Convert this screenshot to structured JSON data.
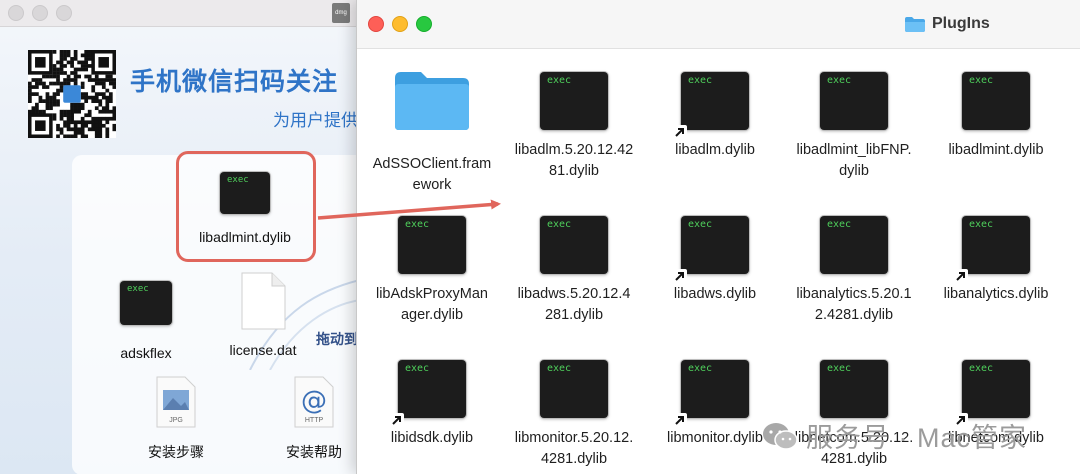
{
  "background_window": {
    "heading": "手机微信扫码关注",
    "subheading": "为用户提供",
    "drag_hint": "拖动到",
    "disk_label": "dmg",
    "highlighted_item": "libadlmint.dylib",
    "exec_badge": "exec",
    "items": [
      {
        "label": "adskflex",
        "kind": "exec"
      },
      {
        "label": "license.dat",
        "kind": "document"
      },
      {
        "label": "安装步骤",
        "kind": "jpg",
        "badge": "JPG"
      },
      {
        "label": "安装帮助",
        "kind": "http",
        "badge": "HTTP"
      }
    ]
  },
  "finder": {
    "title": "PlugIns",
    "exec_badge": "exec",
    "items": [
      {
        "name": "AdSSOClient.framework",
        "lines": [
          "AdSSOClient.fram",
          "ework"
        ],
        "kind": "folder",
        "alias": false
      },
      {
        "name": "libadlm.5.20.12.4281.dylib",
        "lines": [
          "libadlm.5.20.12.42",
          "81.dylib"
        ],
        "kind": "exec",
        "alias": false
      },
      {
        "name": "libadlm.dylib",
        "lines": [
          "libadlm.dylib"
        ],
        "kind": "exec",
        "alias": true
      },
      {
        "name": "libadlmint_libFNP.dylib",
        "lines": [
          "libadlmint_libFNP.",
          "dylib"
        ],
        "kind": "exec",
        "alias": false
      },
      {
        "name": "libadlmint.dylib",
        "lines": [
          "libadlmint.dylib"
        ],
        "kind": "exec",
        "alias": false
      },
      {
        "name": "libAdskProxyManager.dylib",
        "lines": [
          "libAdskProxyMan",
          "ager.dylib"
        ],
        "kind": "exec",
        "alias": false
      },
      {
        "name": "libadws.5.20.12.4281.dylib",
        "lines": [
          "libadws.5.20.12.4",
          "281.dylib"
        ],
        "kind": "exec",
        "alias": false
      },
      {
        "name": "libadws.dylib",
        "lines": [
          "libadws.dylib"
        ],
        "kind": "exec",
        "alias": true
      },
      {
        "name": "libanalytics.5.20.12.4281.dylib",
        "lines": [
          "libanalytics.5.20.1",
          "2.4281.dylib"
        ],
        "kind": "exec",
        "alias": false
      },
      {
        "name": "libanalytics.dylib",
        "lines": [
          "libanalytics.dylib"
        ],
        "kind": "exec",
        "alias": true
      },
      {
        "name": "libidsdk.dylib",
        "lines": [
          "libidsdk.dylib"
        ],
        "kind": "exec",
        "alias": true
      },
      {
        "name": "libmonitor.5.20.12.4281.dylib",
        "lines": [
          "libmonitor.5.20.12.",
          "4281.dylib"
        ],
        "kind": "exec",
        "alias": false
      },
      {
        "name": "libmonitor.dylib",
        "lines": [
          "libmonitor.dylib"
        ],
        "kind": "exec",
        "alias": true
      },
      {
        "name": "libnetcom.5.20.12.4281.dylib",
        "lines": [
          "libnetcom.5.20.12.",
          "4281.dylib"
        ],
        "kind": "exec",
        "alias": false
      },
      {
        "name": "libnetcom.dylib",
        "lines": [
          "libnetcom.dylib"
        ],
        "kind": "exec",
        "alias": true
      }
    ]
  },
  "watermark": {
    "text": "服务号 · Mac管家"
  },
  "colors": {
    "accent_blue": "#2f74c7",
    "highlight_red": "#e0665c",
    "exec_green": "#4fd05c",
    "close": "#fe5f57",
    "minimize": "#febc2e",
    "zoom": "#28c840"
  }
}
